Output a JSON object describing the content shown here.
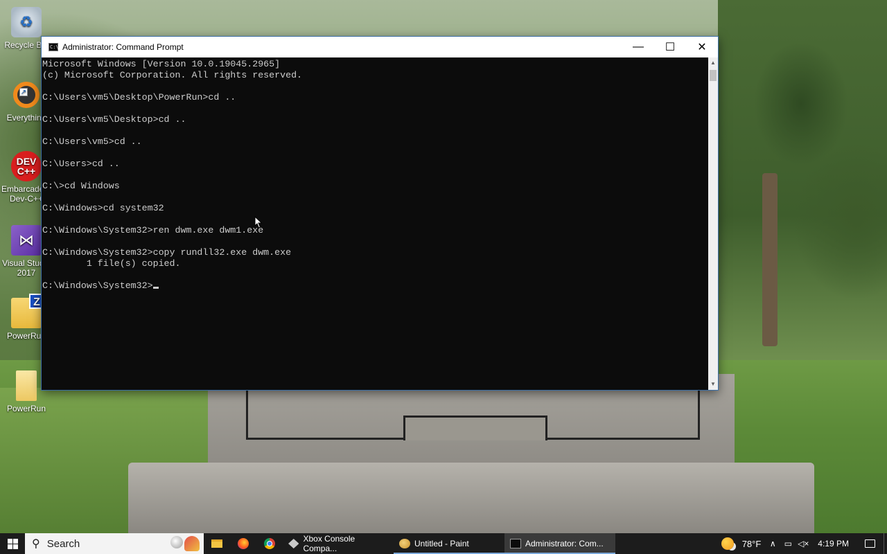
{
  "desktop": {
    "icons": [
      {
        "label": "Recycle Bin",
        "name": "recycle-bin",
        "glyph": "♻"
      },
      {
        "label": "Everything",
        "name": "everything",
        "glyph": ""
      },
      {
        "label": "Embarcadero Dev-C++",
        "name": "dev-cpp",
        "glyph": "DEV C++"
      },
      {
        "label": "Visual Studio 2017",
        "name": "visual-studio",
        "glyph": "⋈"
      },
      {
        "label": "PowerRun",
        "name": "powerrun-shortcut",
        "glyph": "Z"
      },
      {
        "label": "PowerRun",
        "name": "powerrun-folder",
        "glyph": ""
      }
    ]
  },
  "window": {
    "title": "Administrator:  Command Prompt",
    "controls": {
      "minimize": "—",
      "maximize": "☐",
      "close": "✕"
    }
  },
  "console": {
    "lines": [
      "Microsoft Windows [Version 10.0.19045.2965]",
      "(c) Microsoft Corporation. All rights reserved.",
      "",
      "C:\\Users\\vm5\\Desktop\\PowerRun>cd ..",
      "",
      "C:\\Users\\vm5\\Desktop>cd ..",
      "",
      "C:\\Users\\vm5>cd ..",
      "",
      "C:\\Users>cd ..",
      "",
      "C:\\>cd Windows",
      "",
      "C:\\Windows>cd system32",
      "",
      "C:\\Windows\\System32>ren dwm.exe dwm1.exe",
      "",
      "C:\\Windows\\System32>copy rundll32.exe dwm.exe",
      "        1 file(s) copied.",
      "",
      "C:\\Windows\\System32>"
    ],
    "text_color": "#cccccc",
    "background": "#0c0c0c"
  },
  "taskbar": {
    "search_label": "Search",
    "apps": [
      {
        "label": "Xbox Console Compa...",
        "name": "xbox-console-companion"
      },
      {
        "label": "Untitled - Paint",
        "name": "paint"
      },
      {
        "label": "Administrator:  Com...",
        "name": "command-prompt",
        "active": true
      }
    ],
    "weather": "78°F",
    "tray_expand": "∧",
    "time": "4:19 PM"
  }
}
